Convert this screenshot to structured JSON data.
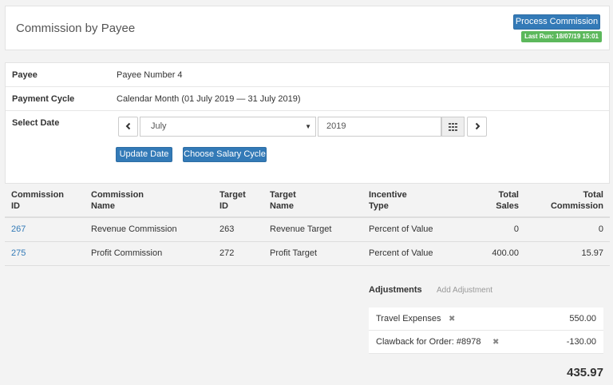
{
  "header": {
    "title": "Commission by Payee",
    "process_button": "Process Commission",
    "last_run": "Last Run: 18/07/19 15:01"
  },
  "details": {
    "payee_label": "Payee",
    "payee_value": "Payee Number 4",
    "cycle_label": "Payment Cycle",
    "cycle_value": "Calendar Month (01 July 2019 — 31 July 2019)",
    "date_label": "Select Date",
    "prev_icon": "chevron-left-icon",
    "next_icon": "chevron-right-icon",
    "month_value": "July",
    "year_value": "2019",
    "calendar_icon": "calendar-grid-icon",
    "update_button": "Update Date",
    "salary_cycle_button": "Choose Salary Cycle"
  },
  "table": {
    "headers": {
      "commission_id_1": "Commission",
      "commission_id_2": "ID",
      "commission_name_1": "Commission",
      "commission_name_2": "Name",
      "target_id_1": "Target",
      "target_id_2": "ID",
      "target_name_1": "Target",
      "target_name_2": "Name",
      "incentive_1": "Incentive",
      "incentive_2": "Type",
      "sales_1": "Total",
      "sales_2": "Sales",
      "commission_1": "Total",
      "commission_2": "Commission"
    },
    "rows": [
      {
        "commission_id": "267",
        "commission_name": "Revenue Commission",
        "target_id": "263",
        "target_name": "Revenue Target",
        "incentive": "Percent of Value",
        "sales": "0",
        "commission": "0"
      },
      {
        "commission_id": "275",
        "commission_name": "Profit Commission",
        "target_id": "272",
        "target_name": "Profit Target",
        "incentive": "Percent of Value",
        "sales": "400.00",
        "commission": "15.97"
      }
    ]
  },
  "adjustments": {
    "title": "Adjustments",
    "add_link": "Add Adjustment",
    "remove_icon": "remove-x-icon",
    "items": [
      {
        "name": "Travel Expenses",
        "amount": "550.00"
      },
      {
        "name": "Clawback for Order: #8978",
        "amount": "-130.00"
      }
    ]
  },
  "total": "435.97",
  "colors": {
    "primary": "#337ab7",
    "success": "#5cb85c",
    "background": "#f3f3f3"
  }
}
